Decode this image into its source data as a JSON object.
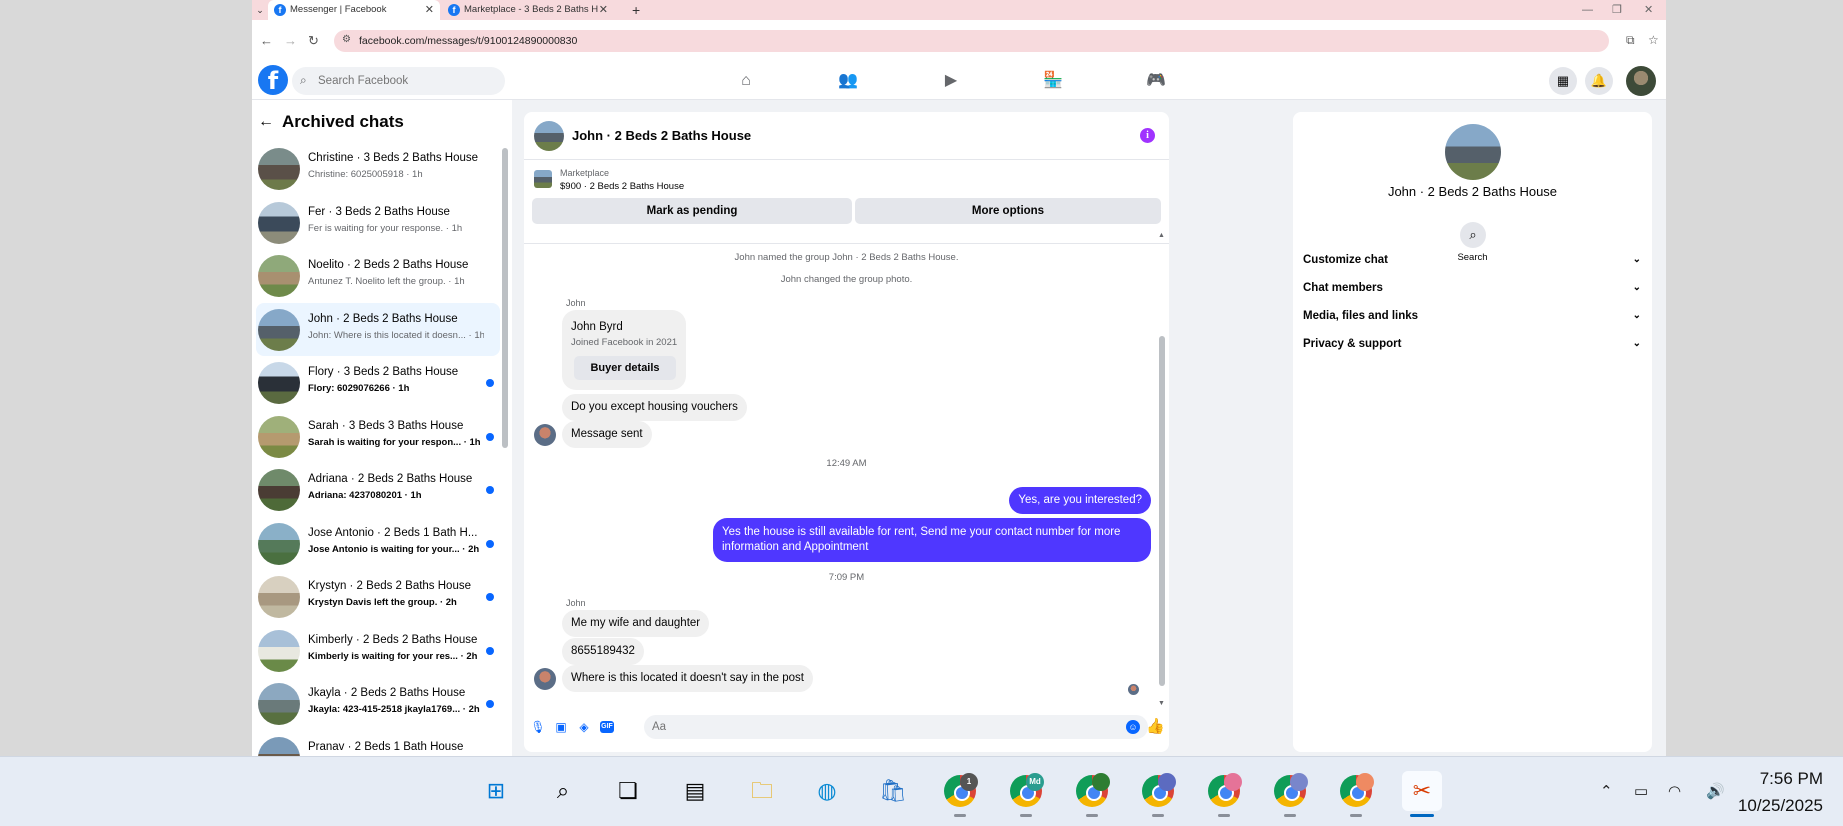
{
  "browser": {
    "tabs": [
      {
        "title": "Messenger | Facebook",
        "active": true
      },
      {
        "title": "Marketplace - 3 Beds 2 Baths H",
        "active": false
      }
    ],
    "url": "facebook.com/messages/t/9100124890000830"
  },
  "facebook": {
    "search_placeholder": "Search Facebook",
    "nav_icons": [
      "home-icon",
      "friends-icon",
      "video-icon",
      "marketplace-icon",
      "gaming-icon"
    ],
    "right_icons": [
      "menu-grid-icon",
      "notifications-icon",
      "profile-avatar"
    ]
  },
  "sidebar": {
    "title": "Archived chats",
    "chats": [
      {
        "name": "Christine · 3 Beds 2 Baths House",
        "preview": "Christine: 6025005918 · 1h",
        "unread": false,
        "active": false,
        "thumb": "h1"
      },
      {
        "name": "Fer · 3 Beds 2 Baths House",
        "preview": "Fer is waiting for your response. · 1h",
        "unread": false,
        "active": false,
        "thumb": "h2"
      },
      {
        "name": "Noelito · 2 Beds 2 Baths House",
        "preview": "Antunez T. Noelito left the group. · 1h",
        "unread": false,
        "active": false,
        "thumb": "h3"
      },
      {
        "name": "John · 2 Beds 2 Baths House",
        "preview": "John: Where is this located it doesn... · 1h",
        "unread": false,
        "active": true,
        "thumb": "h4"
      },
      {
        "name": "Flory · 3 Beds 2 Baths House",
        "preview": "Flory: 6029076266 · 1h",
        "unread": true,
        "active": false,
        "thumb": "h5"
      },
      {
        "name": "Sarah · 3 Beds 3 Baths House",
        "preview": "Sarah is waiting for your respon... · 1h",
        "unread": true,
        "active": false,
        "thumb": "h6"
      },
      {
        "name": "Adriana · 2 Beds 2 Baths House",
        "preview": "Adriana: 4237080201 · 1h",
        "unread": true,
        "active": false,
        "thumb": "h7"
      },
      {
        "name": "Jose Antonio · 2 Beds 1 Bath H...",
        "preview": "Jose Antonio is waiting for your... · 2h",
        "unread": true,
        "active": false,
        "thumb": "h8"
      },
      {
        "name": "Krystyn · 2 Beds 2 Baths House",
        "preview": "Krystyn Davis left the group. · 2h",
        "unread": true,
        "active": false,
        "thumb": "h9"
      },
      {
        "name": "Kimberly · 2 Beds 2 Baths House",
        "preview": "Kimberly is waiting for your res... · 2h",
        "unread": true,
        "active": false,
        "thumb": "h10"
      },
      {
        "name": "Jkayla · 2 Beds 2 Baths House",
        "preview": "Jkayla: 423-415-2518 jkayla1769... · 2h",
        "unread": true,
        "active": false,
        "thumb": "h11"
      },
      {
        "name": "Pranav · 2 Beds 1 Bath House",
        "preview": "",
        "unread": false,
        "active": false,
        "thumb": "h12"
      }
    ]
  },
  "conversation": {
    "title": "John · 2 Beds 2 Baths House",
    "marketplace_label": "Marketplace",
    "listing": "$900 · 2 Beds 2 Baths House",
    "mark_pending": "Mark as pending",
    "more_options": "More options",
    "system_1": "John named the group John · 2 Beds 2 Baths House.",
    "system_2": "John changed the group photo.",
    "sender_1": "John",
    "profile_card": {
      "name": "John Byrd",
      "sub": "Joined Facebook in 2021",
      "button": "Buyer details"
    },
    "in_1": "Do you except housing vouchers",
    "in_2": "Message sent",
    "time_1": "12:49 AM",
    "out_1": "Yes, are you interested?",
    "out_2": "Yes the house is still available for rent, Send me your contact number for more information and Appointment",
    "time_2": "7:09 PM",
    "sender_2": "John",
    "in_3": "Me my wife and daughter",
    "in_4": "8655189432",
    "in_5": "Where is this located it doesn't say in the post",
    "composer_placeholder": "Aa"
  },
  "info_panel": {
    "name": "John · 2 Beds 2 Baths House",
    "search_label": "Search",
    "sections": [
      "Customize chat",
      "Chat members",
      "Media, files and links",
      "Privacy & support"
    ]
  },
  "taskbar": {
    "time": "7:56 PM",
    "date": "10/25/2025",
    "badges": [
      "1",
      "Md"
    ]
  },
  "colors": {
    "facebook_blue": "#1877f2",
    "outgoing_bubble": "#4f37ff",
    "unread_dot": "#0866ff",
    "tab_strip": "#f7dadd"
  }
}
